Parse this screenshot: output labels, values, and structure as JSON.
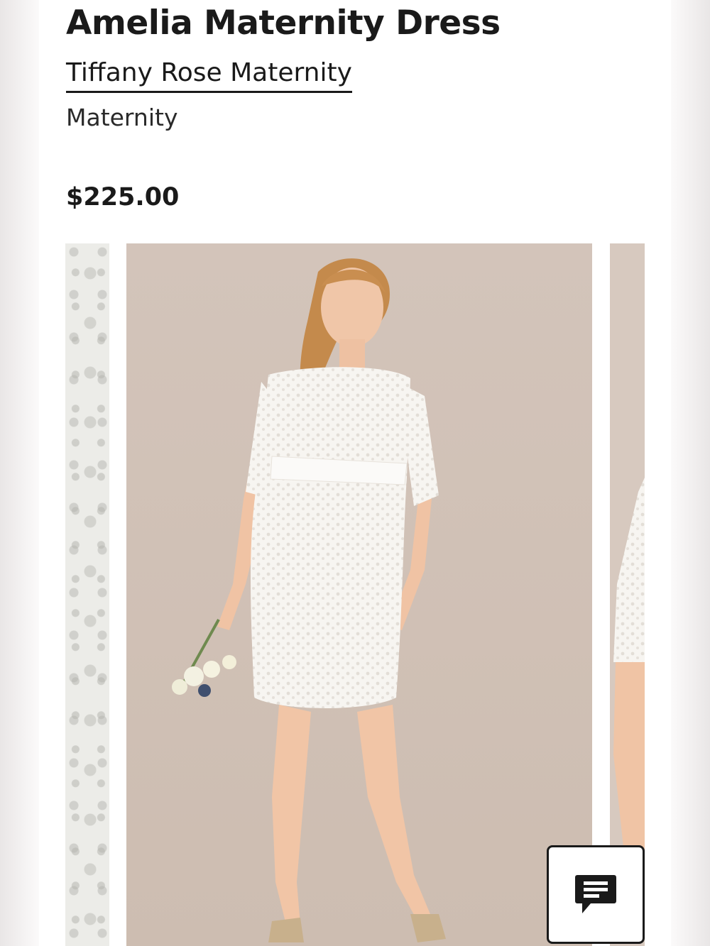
{
  "product": {
    "title": "Amelia Maternity Dress",
    "brand": "Tiffany Rose Maternity",
    "category": "Maternity",
    "price": "$225.00"
  },
  "gallery": {
    "images": [
      {
        "name": "lace-detail-image",
        "description_color": "#eeeeea"
      },
      {
        "name": "product-main-image",
        "description_color": "#d5c7bd"
      },
      {
        "name": "product-side-image",
        "description_color": "#d7c9bf"
      }
    ]
  },
  "chat": {
    "icon": "chat-bubble-icon"
  },
  "colors": {
    "text": "#1a1a1a",
    "background": "#ffffff",
    "photo_backdrop": "#d5c7bd"
  }
}
